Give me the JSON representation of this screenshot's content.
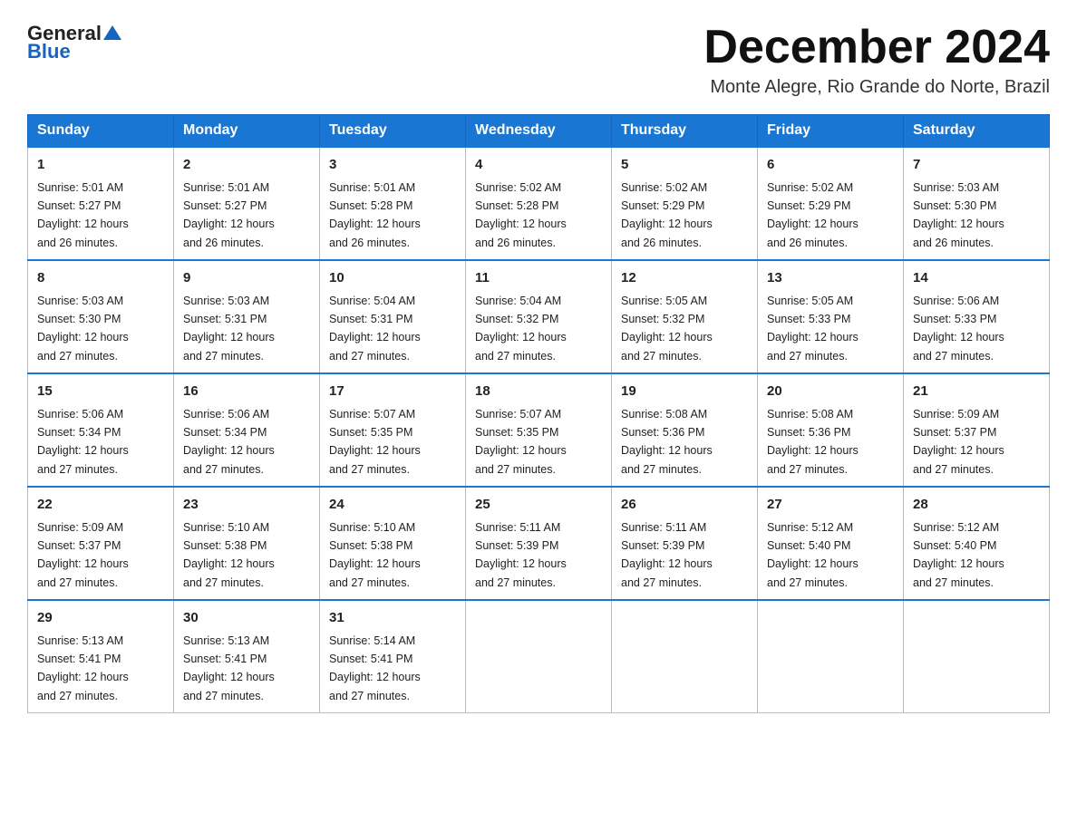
{
  "header": {
    "logo_general": "General",
    "logo_blue": "Blue",
    "month_title": "December 2024",
    "location": "Monte Alegre, Rio Grande do Norte, Brazil"
  },
  "weekdays": [
    "Sunday",
    "Monday",
    "Tuesday",
    "Wednesday",
    "Thursday",
    "Friday",
    "Saturday"
  ],
  "weeks": [
    [
      {
        "day": "1",
        "sunrise": "5:01 AM",
        "sunset": "5:27 PM",
        "daylight": "12 hours and 26 minutes."
      },
      {
        "day": "2",
        "sunrise": "5:01 AM",
        "sunset": "5:27 PM",
        "daylight": "12 hours and 26 minutes."
      },
      {
        "day": "3",
        "sunrise": "5:01 AM",
        "sunset": "5:28 PM",
        "daylight": "12 hours and 26 minutes."
      },
      {
        "day": "4",
        "sunrise": "5:02 AM",
        "sunset": "5:28 PM",
        "daylight": "12 hours and 26 minutes."
      },
      {
        "day": "5",
        "sunrise": "5:02 AM",
        "sunset": "5:29 PM",
        "daylight": "12 hours and 26 minutes."
      },
      {
        "day": "6",
        "sunrise": "5:02 AM",
        "sunset": "5:29 PM",
        "daylight": "12 hours and 26 minutes."
      },
      {
        "day": "7",
        "sunrise": "5:03 AM",
        "sunset": "5:30 PM",
        "daylight": "12 hours and 26 minutes."
      }
    ],
    [
      {
        "day": "8",
        "sunrise": "5:03 AM",
        "sunset": "5:30 PM",
        "daylight": "12 hours and 27 minutes."
      },
      {
        "day": "9",
        "sunrise": "5:03 AM",
        "sunset": "5:31 PM",
        "daylight": "12 hours and 27 minutes."
      },
      {
        "day": "10",
        "sunrise": "5:04 AM",
        "sunset": "5:31 PM",
        "daylight": "12 hours and 27 minutes."
      },
      {
        "day": "11",
        "sunrise": "5:04 AM",
        "sunset": "5:32 PM",
        "daylight": "12 hours and 27 minutes."
      },
      {
        "day": "12",
        "sunrise": "5:05 AM",
        "sunset": "5:32 PM",
        "daylight": "12 hours and 27 minutes."
      },
      {
        "day": "13",
        "sunrise": "5:05 AM",
        "sunset": "5:33 PM",
        "daylight": "12 hours and 27 minutes."
      },
      {
        "day": "14",
        "sunrise": "5:06 AM",
        "sunset": "5:33 PM",
        "daylight": "12 hours and 27 minutes."
      }
    ],
    [
      {
        "day": "15",
        "sunrise": "5:06 AM",
        "sunset": "5:34 PM",
        "daylight": "12 hours and 27 minutes."
      },
      {
        "day": "16",
        "sunrise": "5:06 AM",
        "sunset": "5:34 PM",
        "daylight": "12 hours and 27 minutes."
      },
      {
        "day": "17",
        "sunrise": "5:07 AM",
        "sunset": "5:35 PM",
        "daylight": "12 hours and 27 minutes."
      },
      {
        "day": "18",
        "sunrise": "5:07 AM",
        "sunset": "5:35 PM",
        "daylight": "12 hours and 27 minutes."
      },
      {
        "day": "19",
        "sunrise": "5:08 AM",
        "sunset": "5:36 PM",
        "daylight": "12 hours and 27 minutes."
      },
      {
        "day": "20",
        "sunrise": "5:08 AM",
        "sunset": "5:36 PM",
        "daylight": "12 hours and 27 minutes."
      },
      {
        "day": "21",
        "sunrise": "5:09 AM",
        "sunset": "5:37 PM",
        "daylight": "12 hours and 27 minutes."
      }
    ],
    [
      {
        "day": "22",
        "sunrise": "5:09 AM",
        "sunset": "5:37 PM",
        "daylight": "12 hours and 27 minutes."
      },
      {
        "day": "23",
        "sunrise": "5:10 AM",
        "sunset": "5:38 PM",
        "daylight": "12 hours and 27 minutes."
      },
      {
        "day": "24",
        "sunrise": "5:10 AM",
        "sunset": "5:38 PM",
        "daylight": "12 hours and 27 minutes."
      },
      {
        "day": "25",
        "sunrise": "5:11 AM",
        "sunset": "5:39 PM",
        "daylight": "12 hours and 27 minutes."
      },
      {
        "day": "26",
        "sunrise": "5:11 AM",
        "sunset": "5:39 PM",
        "daylight": "12 hours and 27 minutes."
      },
      {
        "day": "27",
        "sunrise": "5:12 AM",
        "sunset": "5:40 PM",
        "daylight": "12 hours and 27 minutes."
      },
      {
        "day": "28",
        "sunrise": "5:12 AM",
        "sunset": "5:40 PM",
        "daylight": "12 hours and 27 minutes."
      }
    ],
    [
      {
        "day": "29",
        "sunrise": "5:13 AM",
        "sunset": "5:41 PM",
        "daylight": "12 hours and 27 minutes."
      },
      {
        "day": "30",
        "sunrise": "5:13 AM",
        "sunset": "5:41 PM",
        "daylight": "12 hours and 27 minutes."
      },
      {
        "day": "31",
        "sunrise": "5:14 AM",
        "sunset": "5:41 PM",
        "daylight": "12 hours and 27 minutes."
      },
      null,
      null,
      null,
      null
    ]
  ],
  "labels": {
    "sunrise": "Sunrise:",
    "sunset": "Sunset:",
    "daylight": "Daylight:"
  }
}
